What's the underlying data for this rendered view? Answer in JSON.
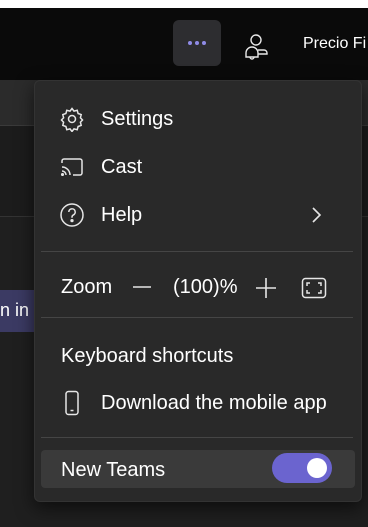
{
  "titlebar": {
    "more_button_icon": "more-horizontal-icon",
    "notification_icon": "person-bell-icon",
    "user_name": "Precio Fi"
  },
  "background": {
    "chip_text": "n in c"
  },
  "menu": {
    "items": [
      {
        "label": "Settings",
        "icon": "gear-icon"
      },
      {
        "label": "Cast",
        "icon": "cast-icon"
      },
      {
        "label": "Help",
        "icon": "help-circle-icon",
        "has_submenu": true
      }
    ],
    "zoom": {
      "label": "Zoom",
      "value": "(100)%",
      "minus_icon": "minus-icon",
      "plus_icon": "plus-icon",
      "fit_icon": "fit-screen-icon"
    },
    "keyboard_shortcuts": "Keyboard shortcuts",
    "download_app": {
      "label": "Download the mobile app",
      "icon": "phone-icon"
    },
    "new_teams": {
      "label": "New Teams",
      "enabled": true
    }
  },
  "colors": {
    "accent": "#6b64cf",
    "dots": "#8f8be6",
    "menu_bg": "#292929"
  }
}
